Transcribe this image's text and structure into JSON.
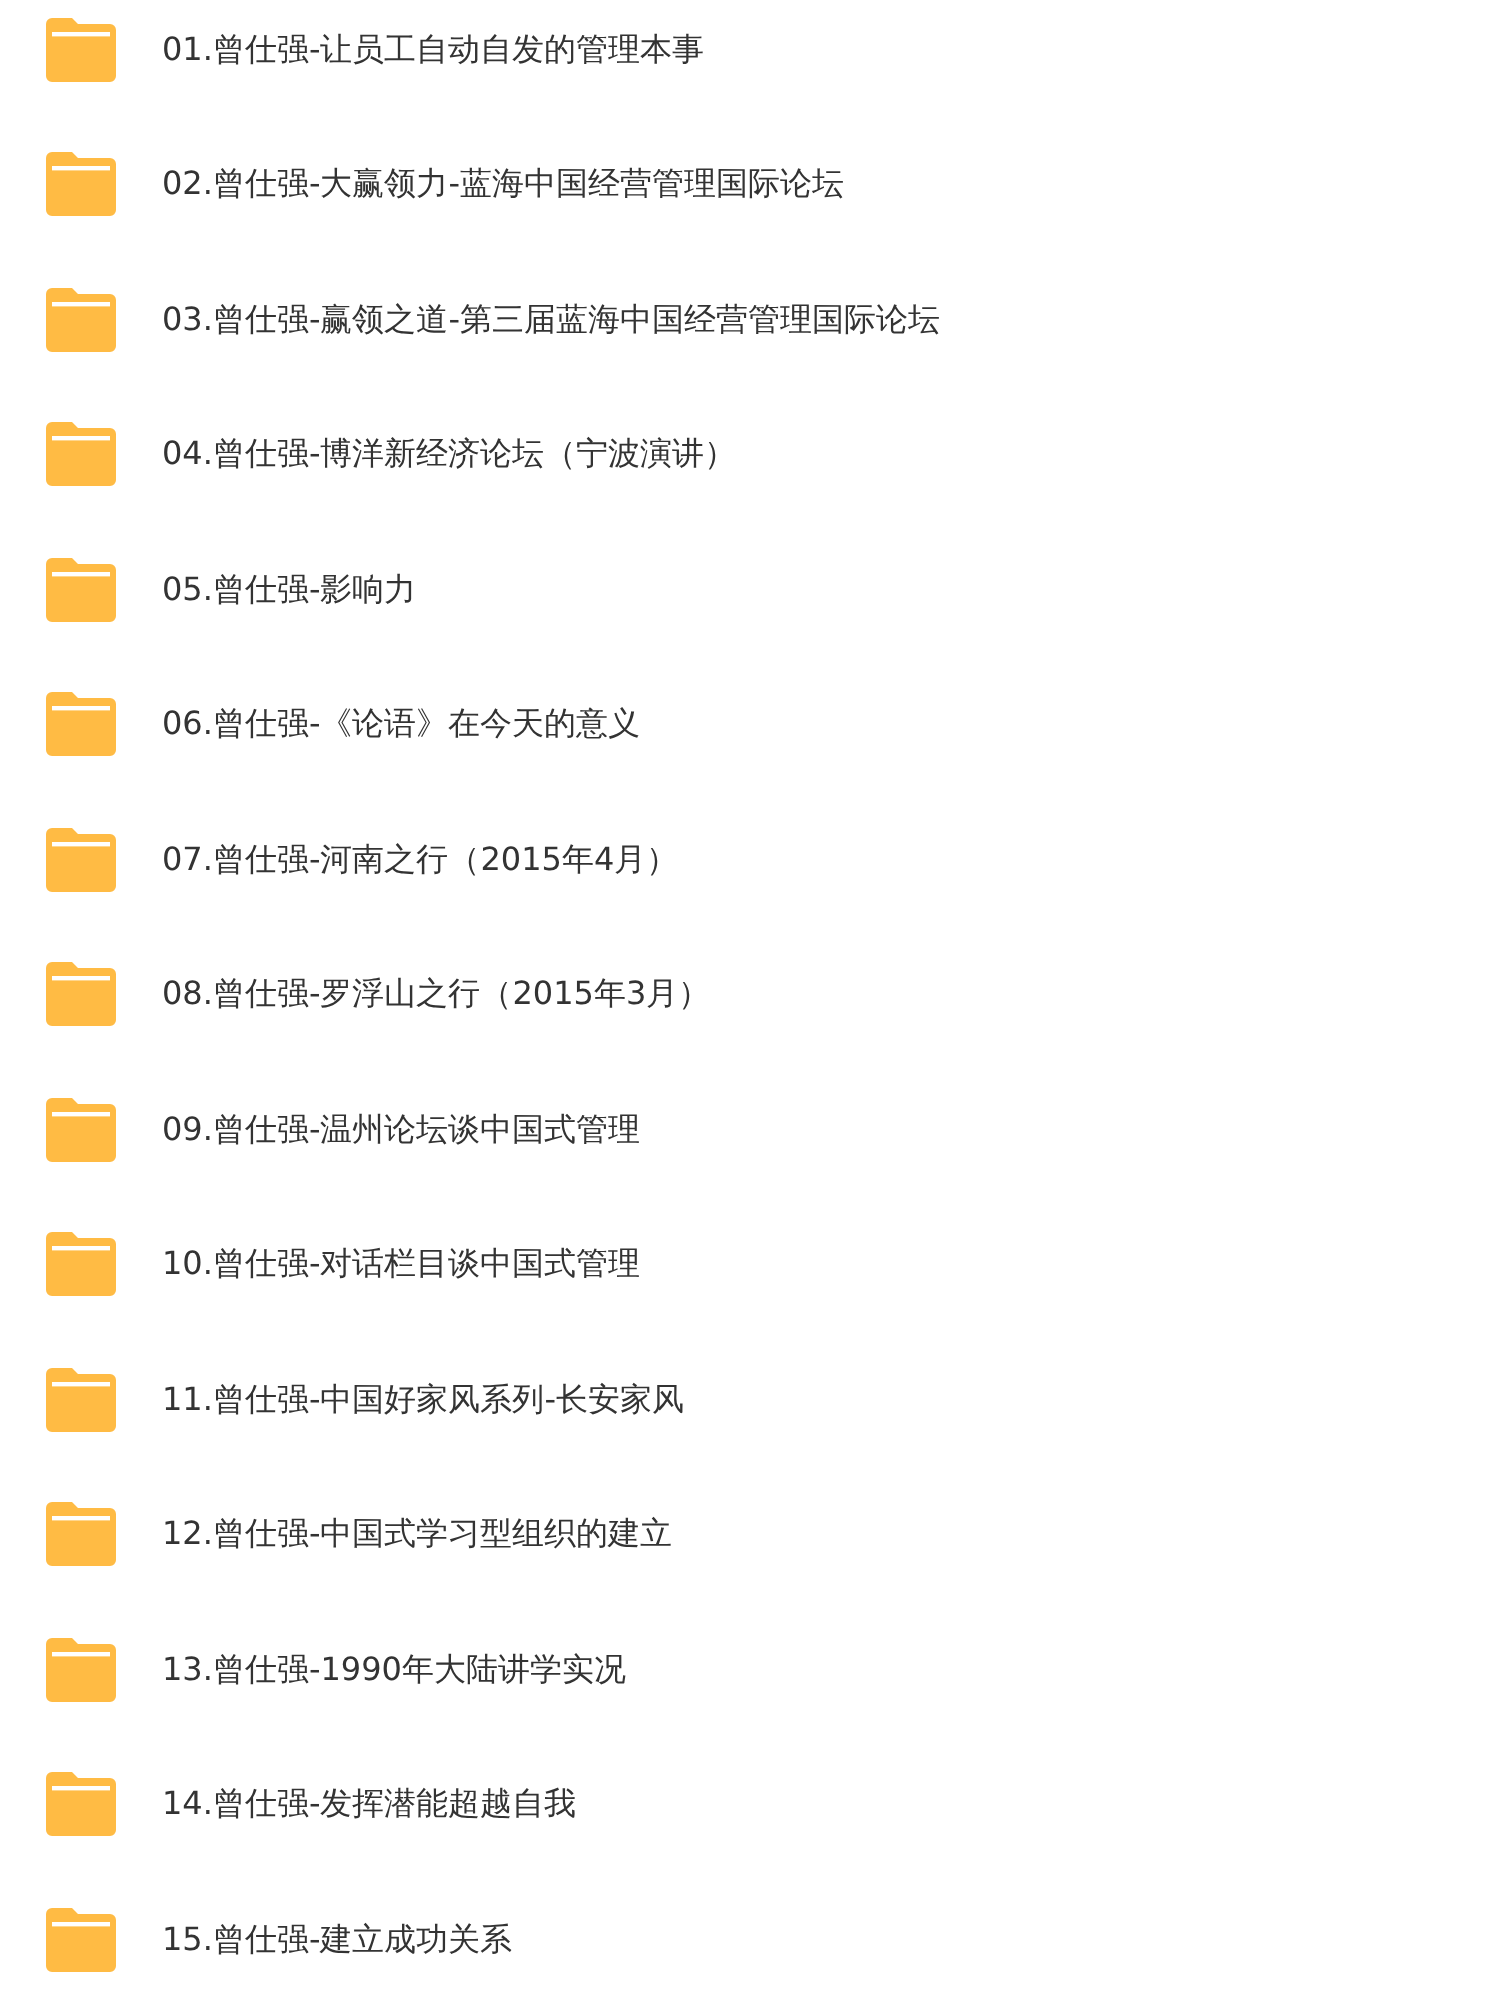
{
  "folders": [
    {
      "name": "01.曾仕强-让员工自动自发的管理本事"
    },
    {
      "name": "02.曾仕强-大赢领力-蓝海中国经营管理国际论坛"
    },
    {
      "name": "03.曾仕强-赢领之道-第三届蓝海中国经营管理国际论坛"
    },
    {
      "name": "04.曾仕强-博洋新经济论坛（宁波演讲）"
    },
    {
      "name": "05.曾仕强-影响力"
    },
    {
      "name": "06.曾仕强-《论语》在今天的意义"
    },
    {
      "name": "07.曾仕强-河南之行（2015年4月）"
    },
    {
      "name": "08.曾仕强-罗浮山之行（2015年3月）"
    },
    {
      "name": "09.曾仕强-温州论坛谈中国式管理"
    },
    {
      "name": "10.曾仕强-对话栏目谈中国式管理"
    },
    {
      "name": "11.曾仕强-中国好家风系列-长安家风"
    },
    {
      "name": "12.曾仕强-中国式学习型组织的建立"
    },
    {
      "name": "13.曾仕强-1990年大陆讲学实况"
    },
    {
      "name": "14.曾仕强-发挥潜能超越自我"
    },
    {
      "name": "15.曾仕强-建立成功关系"
    }
  ]
}
